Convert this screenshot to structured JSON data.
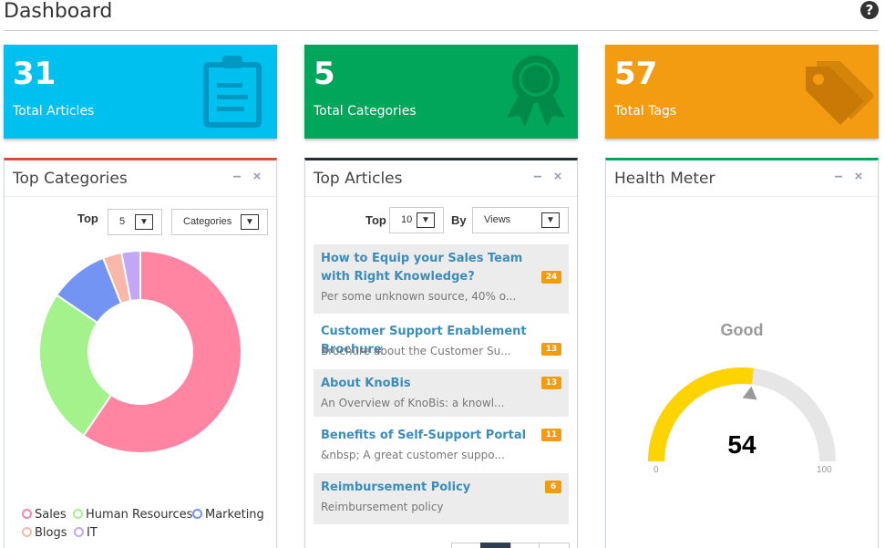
{
  "header": {
    "title": "Dashboard",
    "help_glyph": "?"
  },
  "stats": [
    {
      "value": "31",
      "label": "Total Articles",
      "icon": "clipboard-icon",
      "color": "#00c0ef"
    },
    {
      "value": "5",
      "label": "Total Categories",
      "icon": "ribbon-award-icon",
      "color": "#00a65a"
    },
    {
      "value": "57",
      "label": "Total Tags",
      "icon": "tags-icon",
      "color": "#f39c12"
    }
  ],
  "top_categories": {
    "title": "Top Categories",
    "top_label": "Top",
    "top_value": "5",
    "by_value": "Categories",
    "legend": [
      {
        "name": "Sales",
        "color": "#ff85a2"
      },
      {
        "name": "Human Resources",
        "color": "#a3f28c"
      },
      {
        "name": "Marketing",
        "color": "#7394f2"
      },
      {
        "name": "Blogs",
        "color": "#f8b7a8"
      },
      {
        "name": "IT",
        "color": "#c3a7f7"
      }
    ]
  },
  "chart_data": {
    "type": "pie",
    "donut": true,
    "categories": [
      "Sales",
      "Human Resources",
      "Marketing",
      "Blogs",
      "IT"
    ],
    "values": [
      59.5,
      25,
      9.5,
      3,
      3
    ],
    "colors": [
      "#ff85a2",
      "#a3f28c",
      "#7394f2",
      "#f8b7a8",
      "#c3a7f7"
    ],
    "legend": "bottom"
  },
  "top_articles": {
    "title": "Top Articles",
    "top_label": "Top",
    "top_value": "10",
    "by_label": "By",
    "by_value": "Views",
    "items": [
      {
        "title": "How to Equip your Sales Team with Right Knowledge?",
        "desc": "Per some unknown source, 40% o...",
        "count": "24"
      },
      {
        "title": "Customer Support Enablement Brochure",
        "desc": "Brochure about the Customer Su...",
        "count": "13"
      },
      {
        "title": "About KnoBis",
        "desc": "An Overview of KnoBis: a knowl...",
        "count": "13"
      },
      {
        "title": "Benefits of Self-Support Portal",
        "desc": "&nbsp; A great customer suppo...",
        "count": "11"
      },
      {
        "title": "Reimbursement Policy",
        "desc": "Reimbursement policy",
        "count": "6"
      }
    ]
  },
  "health": {
    "title": "Health Meter",
    "status": "Good",
    "value": "54",
    "value_num": 54,
    "min": "0",
    "max": "100",
    "fill_color": "#fdd400",
    "track_color": "#e6e6e6"
  },
  "panel_tools": {
    "minimize": "−",
    "close": "×"
  }
}
